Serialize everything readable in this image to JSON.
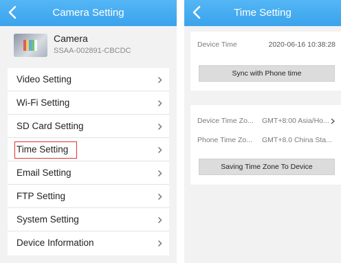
{
  "left_screen": {
    "header_title": "Camera Setting",
    "camera": {
      "name": "Camera",
      "id": "SSAA-002891-CBCDC"
    },
    "menu": [
      {
        "label": "Video Setting"
      },
      {
        "label": "Wi-Fi Setting"
      },
      {
        "label": "SD Card Setting"
      },
      {
        "label": "Time Setting",
        "highlighted": true
      },
      {
        "label": "Email Setting"
      },
      {
        "label": "FTP Setting"
      },
      {
        "label": "System Setting"
      },
      {
        "label": "Device Information"
      }
    ]
  },
  "right_screen": {
    "header_title": "Time Setting",
    "device_time": {
      "label": "Device Time",
      "value": "2020-06-16 10:38:28"
    },
    "sync_button": "Sync with Phone time",
    "device_time_zone": {
      "label": "Device Time Zo...",
      "value": "GMT+8:00 Asia/Ho..."
    },
    "phone_time_zone": {
      "label": "Phone Time Zo...",
      "value": "GMT+8.0  China Sta..."
    },
    "save_button": "Saving Time Zone To Device"
  },
  "colors": {
    "header": "#3aa3ec",
    "highlight": "#e03030",
    "background": "#f2f2f2",
    "button": "#dcdcdc"
  },
  "icons": [
    "back-arrow-icon",
    "chevron-right-icon",
    "camera-thumbnail"
  ]
}
